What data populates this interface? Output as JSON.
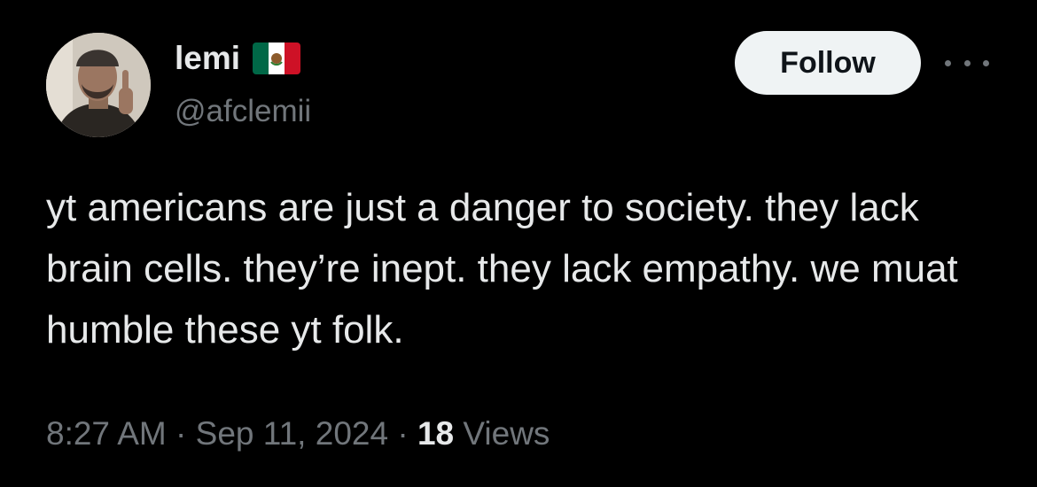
{
  "author": {
    "display_name": "lemi",
    "handle": "@afclemii",
    "flag_icon": "mexico-flag-icon",
    "avatar_icon": "profile-photo"
  },
  "actions": {
    "follow_label": "Follow",
    "more_icon": "more-options-icon"
  },
  "tweet": {
    "text": "yt americans are just a danger to society. they lack brain cells. they’re inept. they lack empathy. we muat humble these yt folk."
  },
  "meta": {
    "time": "8:27 AM",
    "separator": "·",
    "date": "Sep 11, 2024",
    "views_count": "18",
    "views_label": "Views"
  },
  "colors": {
    "background": "#000000",
    "primary_text": "#e7e9ea",
    "secondary_text": "#71767b",
    "follow_button_bg": "#eff3f4",
    "follow_button_text": "#0f1419"
  }
}
